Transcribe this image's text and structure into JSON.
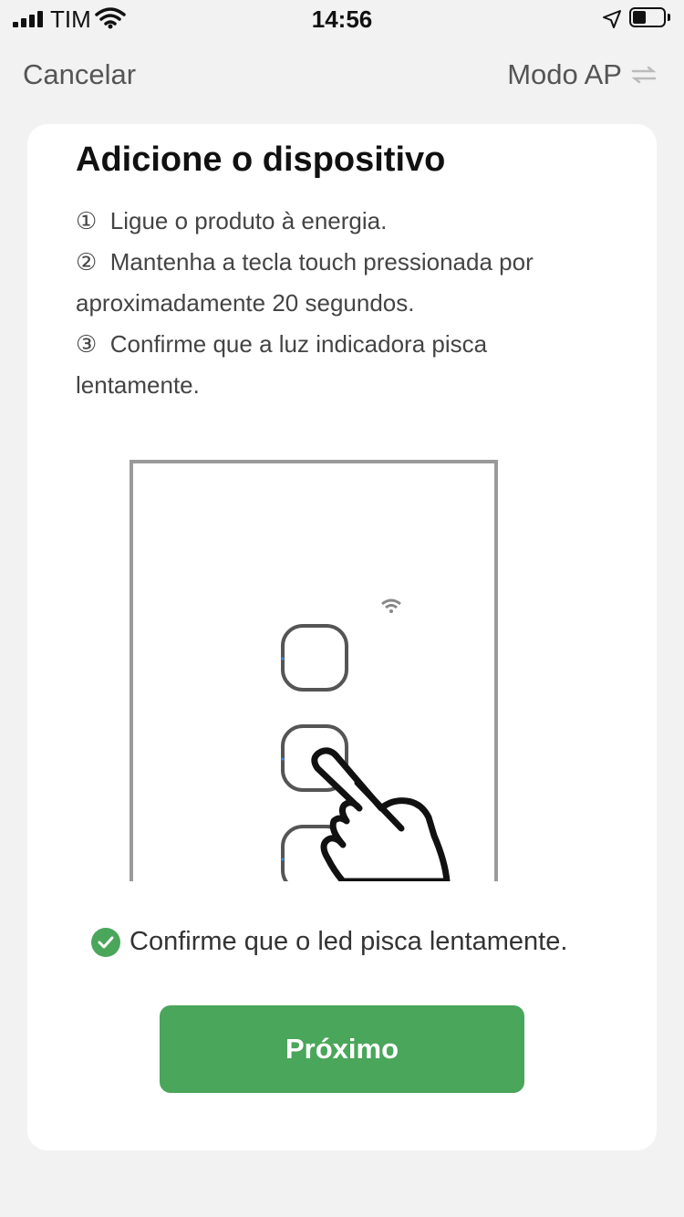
{
  "status_bar": {
    "carrier": "TIM",
    "time": "14:56"
  },
  "nav": {
    "cancel_label": "Cancelar",
    "mode_label": "Modo AP"
  },
  "card": {
    "title": "Adicione o dispositivo",
    "steps": [
      {
        "marker": "①",
        "text": "Ligue o produto à energia."
      },
      {
        "marker": "②",
        "text": "Mantenha a tecla touch pressionada por aproximadamente 20 segundos."
      },
      {
        "marker": "③",
        "text": "Confirme que a luz indicadora pisca lentamente."
      }
    ],
    "illustration": "wall-touch-switch-press-illustration",
    "confirm_text": "Confirme que o led pisca lentamente.",
    "confirm_checked": true,
    "next_label": "Próximo"
  },
  "colors": {
    "accent": "#4aa65a",
    "background": "#f2f2f2",
    "card": "#ffffff"
  }
}
